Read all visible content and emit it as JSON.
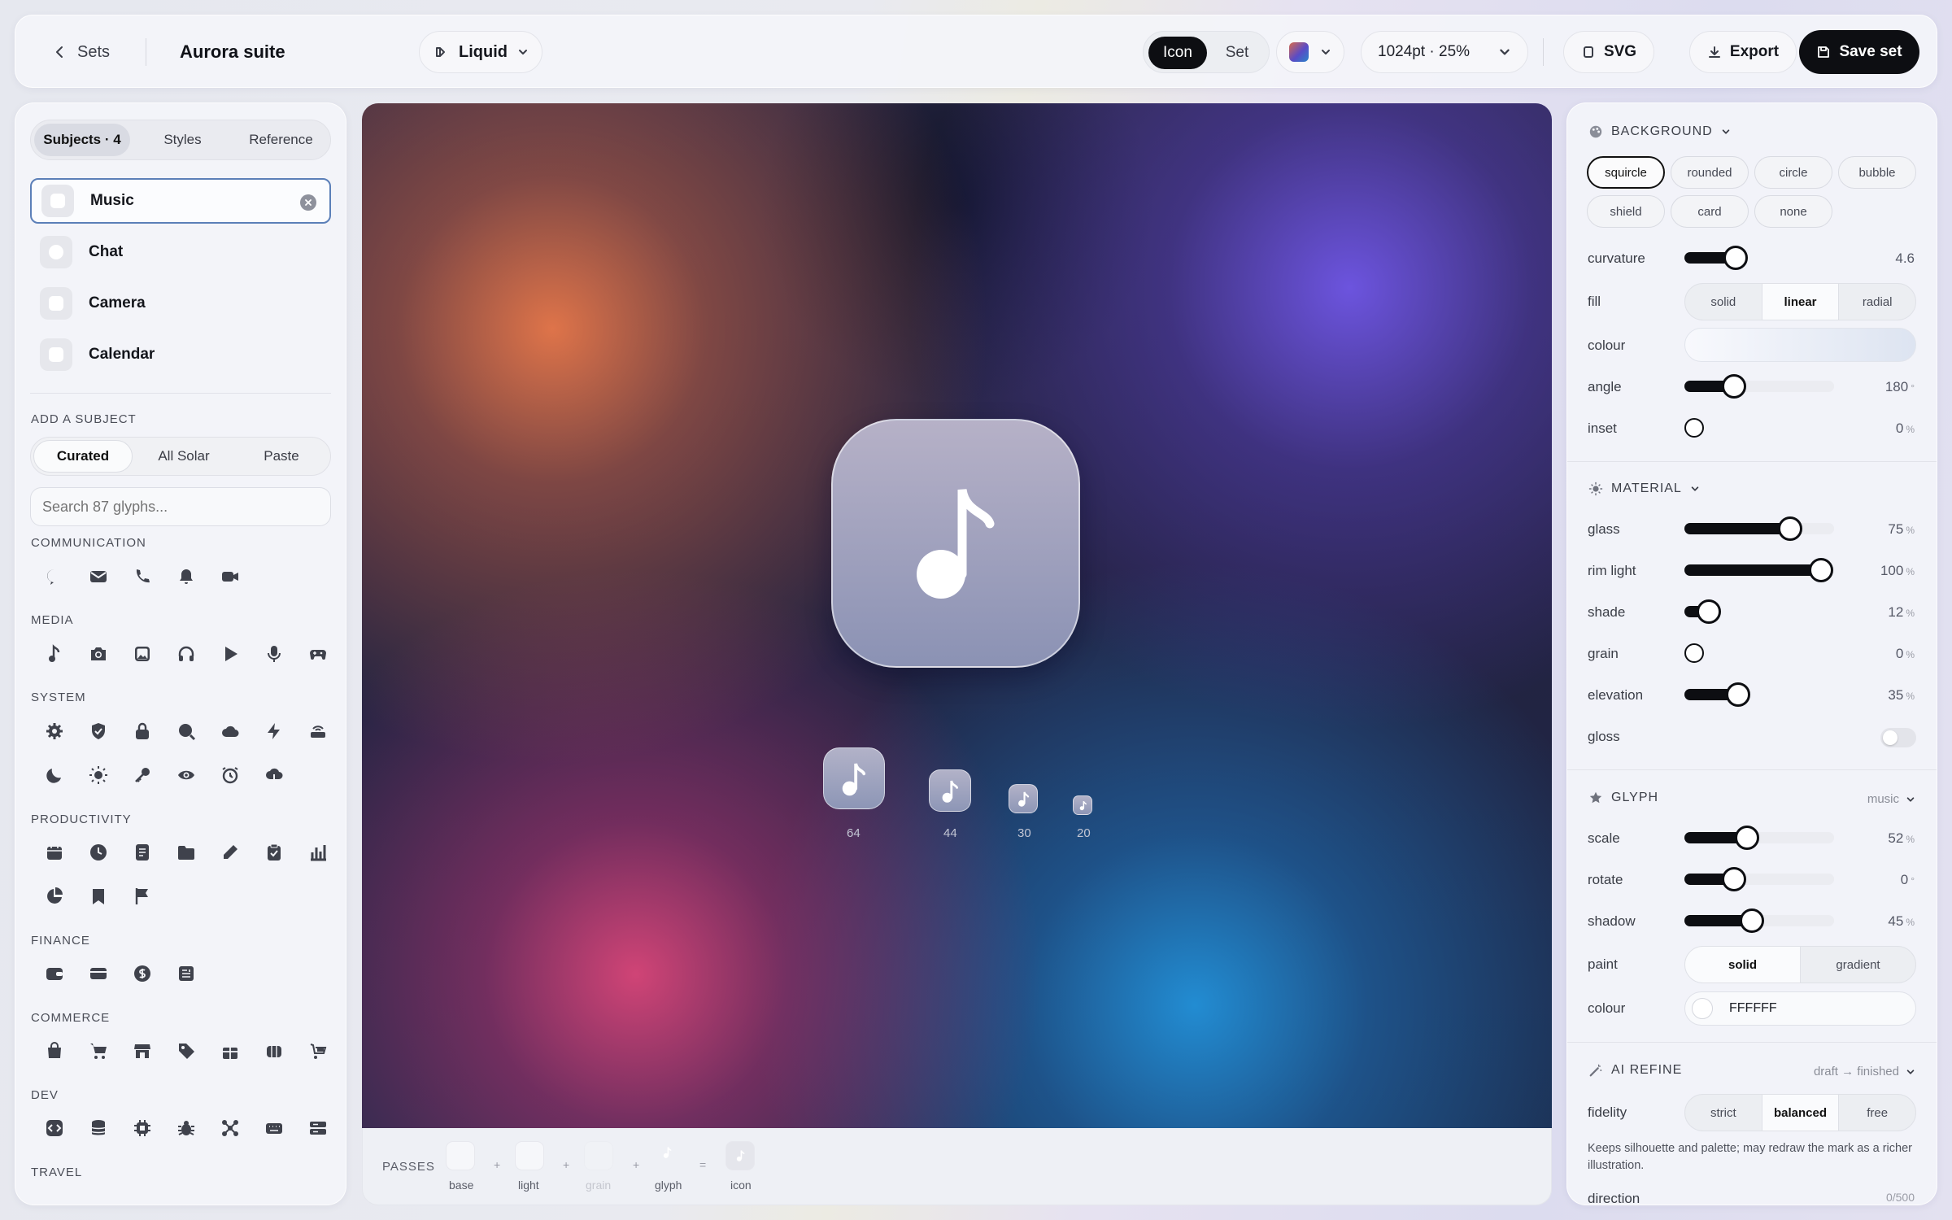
{
  "topbar": {
    "back_label": "Sets",
    "title": "Aurora suite",
    "style_select": "Liquid",
    "mode_tabs": [
      "Icon",
      "Set"
    ],
    "size_select": "1024pt · 25%",
    "svg_label": "SVG",
    "export_label": "Export",
    "save_label": "Save set"
  },
  "left": {
    "tabs": [
      "Subjects · 4",
      "Styles",
      "Reference"
    ],
    "subjects": [
      "Music",
      "Chat",
      "Camera",
      "Calendar"
    ],
    "add_heading": "ADD A SUBJECT",
    "source_tabs": [
      "Curated",
      "All Solar",
      "Paste"
    ],
    "search_placeholder": "Search 87 glyphs...",
    "categories": [
      {
        "name": "COMMUNICATION",
        "icons": [
          "chat-bubble-icon",
          "mail-icon",
          "phone-icon",
          "bell-icon",
          "video-icon"
        ]
      },
      {
        "name": "MEDIA",
        "icons": [
          "music-note-icon",
          "camera-icon",
          "image-icon",
          "headphones-icon",
          "play-icon",
          "microphone-icon",
          "gamepad-icon"
        ]
      },
      {
        "name": "SYSTEM",
        "icons": [
          "gear-icon",
          "shield-icon",
          "lock-icon",
          "search-icon",
          "cloud-icon",
          "lightning-icon",
          "router-icon",
          "moon-icon",
          "sun-icon",
          "key-icon",
          "eye-icon",
          "alarm-icon",
          "cloud-download-icon"
        ]
      },
      {
        "name": "PRODUCTIVITY",
        "icons": [
          "calendar-icon",
          "clock-icon",
          "document-icon",
          "folder-icon",
          "pencil-icon",
          "clipboard-icon",
          "bar-chart-icon",
          "pie-chart-icon",
          "bookmark-icon",
          "flag-icon"
        ]
      },
      {
        "name": "FINANCE",
        "icons": [
          "wallet-icon",
          "card-icon",
          "dollar-icon",
          "receipt-icon"
        ]
      },
      {
        "name": "COMMERCE",
        "icons": [
          "bag-icon",
          "cart-icon",
          "shop-icon",
          "tag-icon",
          "gift-icon",
          "box-icon",
          "cash-cart-icon"
        ]
      },
      {
        "name": "DEV",
        "icons": [
          "code-icon",
          "database-icon",
          "chip-icon",
          "bug-icon",
          "network-icon",
          "keyboard-icon",
          "server-icon"
        ]
      },
      {
        "name": "TRAVEL",
        "icons": []
      }
    ]
  },
  "canvas": {
    "preview_sizes": [
      "64",
      "44",
      "30",
      "20"
    ]
  },
  "passes": {
    "label": "PASSES",
    "steps": [
      "base",
      "light",
      "grain",
      "glyph",
      "icon"
    ],
    "ops": [
      "+",
      "+",
      "+",
      "="
    ]
  },
  "right": {
    "background": {
      "heading": "BACKGROUND",
      "shapes": [
        "squircle",
        "rounded",
        "circle",
        "bubble",
        "shield",
        "card",
        "none"
      ],
      "selected_shape": "squircle",
      "curvature_label": "curvature",
      "curvature": "4.6",
      "curvature_frac": 0.23,
      "fill_label": "fill",
      "fill_options": [
        "solid",
        "linear",
        "radial"
      ],
      "fill_selected": "linear",
      "colour_label": "colour",
      "angle_label": "angle",
      "angle": "180",
      "angle_unit": "°",
      "angle_frac": 0.33,
      "inset_label": "inset",
      "inset": "0",
      "inset_unit": "%",
      "inset_frac": 0
    },
    "material": {
      "heading": "MATERIAL",
      "sliders": [
        {
          "label": "glass",
          "value": "75",
          "frac": 0.47
        },
        {
          "label": "rim light",
          "value": "100",
          "frac": 0.61
        },
        {
          "label": "shade",
          "value": "12",
          "frac": 0.11
        },
        {
          "label": "grain",
          "value": "0",
          "frac": 0
        },
        {
          "label": "elevation",
          "value": "35",
          "frac": 0.24
        }
      ],
      "unit": "%",
      "gloss_label": "gloss"
    },
    "glyph": {
      "heading": "GLYPH",
      "current": "music",
      "scale_label": "scale",
      "scale": "52",
      "scale_unit": "%",
      "scale_frac": 0.28,
      "rotate_label": "rotate",
      "rotate": "0",
      "rotate_unit": "°",
      "rotate_frac": 0.33,
      "shadow_label": "shadow",
      "shadow": "45",
      "shadow_unit": "%",
      "shadow_frac": 0.3,
      "paint_label": "paint",
      "paint_options": [
        "solid",
        "gradient"
      ],
      "paint_selected": "solid",
      "colour_label": "colour",
      "colour_value": "FFFFFF"
    },
    "ai_refine": {
      "heading": "AI REFINE",
      "mode": "draft → finished",
      "fidelity_label": "fidelity",
      "fidelity_options": [
        "strict",
        "balanced",
        "free"
      ],
      "fidelity_selected": "balanced",
      "description": "Keeps silhouette and palette; may redraw the mark as a richer illustration.",
      "direction_label": "direction",
      "direction_count": "0/500"
    }
  },
  "colors": {
    "accent": "#0d0e12",
    "selected_subject_border": "#5b7fb8"
  }
}
